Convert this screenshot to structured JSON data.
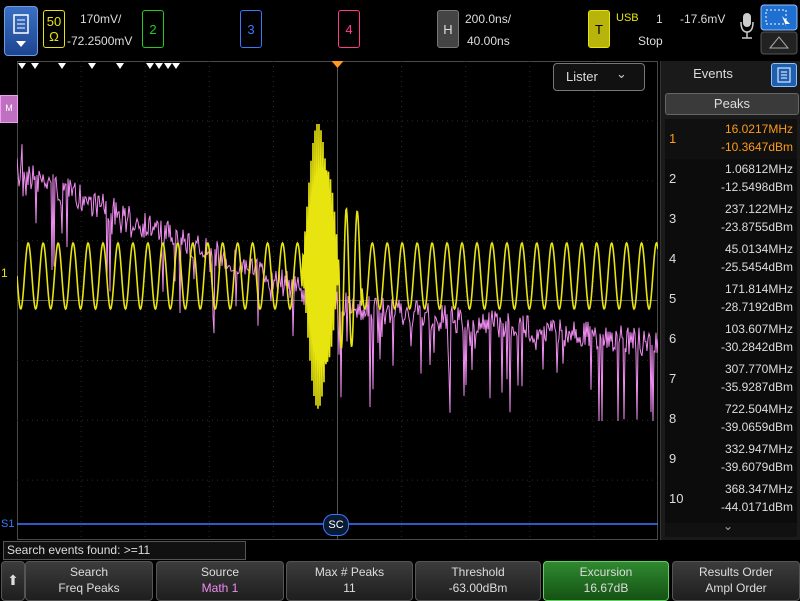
{
  "colors": {
    "ch1": "#e8e410",
    "math": "#f08cf0",
    "blue": "#3a78ff",
    "green": "#22cc22",
    "red": "#ff3c8c",
    "orange": "#ff9a1a"
  },
  "top": {
    "ch1_coupling": "50 Ω",
    "ch1_coupling_a": "50",
    "ch1_coupling_b": "Ω",
    "ch1_scale": "170mV/",
    "ch1_offset": "-72.2500mV",
    "ch2": "2",
    "ch3": "3",
    "ch4": "4",
    "h_label": "H",
    "h_scale": "200.0ns/",
    "h_delay": "40.00ns",
    "t_label": "T",
    "usb": "USB",
    "trig_src": "1",
    "trig_level": "-17.6mV",
    "run_state": "Stop"
  },
  "screen": {
    "lister_label": "Lister",
    "math_marker": "M",
    "ch1_marker": "1",
    "s1_marker": "S1",
    "sc_marker": "SC"
  },
  "events_panel": {
    "title": "Events",
    "peaks_button": "Peaks",
    "rows": [
      {
        "idx": "1",
        "freq": "16.0217MHz",
        "amp": "-10.3647dBm"
      },
      {
        "idx": "2",
        "freq": "1.06812MHz",
        "amp": "-12.5498dBm"
      },
      {
        "idx": "3",
        "freq": "237.122MHz",
        "amp": "-23.8755dBm"
      },
      {
        "idx": "4",
        "freq": "45.0134MHz",
        "amp": "-25.5454dBm"
      },
      {
        "idx": "5",
        "freq": "171.814MHz",
        "amp": "-28.7192dBm"
      },
      {
        "idx": "6",
        "freq": "103.607MHz",
        "amp": "-30.2842dBm"
      },
      {
        "idx": "7",
        "freq": "307.770MHz",
        "amp": "-35.9287dBm"
      },
      {
        "idx": "8",
        "freq": "722.504MHz",
        "amp": "-39.0659dBm"
      },
      {
        "idx": "9",
        "freq": "332.947MHz",
        "amp": "-39.6079dBm"
      },
      {
        "idx": "10",
        "freq": "368.347MHz",
        "amp": "-44.0171dBm"
      }
    ]
  },
  "status": "Search events found: >=11",
  "softkeys": [
    {
      "title": "Search",
      "value": "Freq Peaks"
    },
    {
      "title": "Source",
      "value": "Math 1"
    },
    {
      "title": "Max # Peaks",
      "value": "11"
    },
    {
      "title": "Threshold",
      "value": "-63.00dBm"
    },
    {
      "title": "Excursion",
      "value": "16.67dB"
    },
    {
      "title": "Results Order",
      "value": "Ampl Order"
    }
  ]
}
